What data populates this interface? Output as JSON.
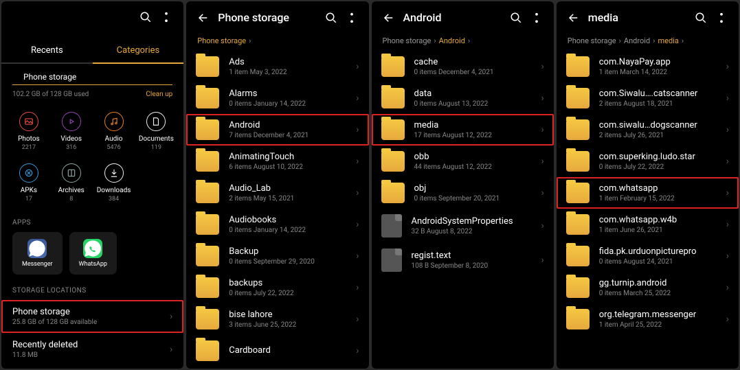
{
  "panel1": {
    "tabs": {
      "recents": "Recents",
      "categories": "Categories"
    },
    "storage_label": "Phone storage",
    "usage": "102.2 GB of 128 GB used",
    "cleanup": "Clean up",
    "cats": [
      {
        "name": "Photos",
        "count": "2217",
        "color": "#e84c3d"
      },
      {
        "name": "Videos",
        "count": "316",
        "color": "#8e44ad"
      },
      {
        "name": "Audio",
        "count": "5476",
        "color": "#e67e22"
      },
      {
        "name": "Documents",
        "count": "119",
        "color": "#ecf0f1"
      },
      {
        "name": "APKs",
        "count": "17",
        "color": "#3498db"
      },
      {
        "name": "Archives",
        "count": "8",
        "color": "#95a5a6"
      },
      {
        "name": "Downloads",
        "count": "384",
        "color": "#ecf0f1"
      }
    ],
    "apps_label": "APPS",
    "apps": [
      {
        "name": "Messenger"
      },
      {
        "name": "WhatsApp"
      }
    ],
    "loc_label": "STORAGE LOCATIONS",
    "locs": [
      {
        "name": "Phone storage",
        "meta": "25.8 GB of 128 GB available",
        "hl": true
      },
      {
        "name": "Recently deleted",
        "meta": "11.8 MB",
        "hl": false
      }
    ]
  },
  "panel2": {
    "title": "Phone storage",
    "crumbs": [
      "Phone storage"
    ],
    "items": [
      {
        "name": "Ads",
        "meta": "1 item    May 3, 2022",
        "type": "folder"
      },
      {
        "name": "Alarms",
        "meta": "0 items    January 14, 2022",
        "type": "folder"
      },
      {
        "name": "Android",
        "meta": "7 items    December 4, 2021",
        "type": "folder",
        "hl": true
      },
      {
        "name": "AnimatingTouch",
        "meta": "6 items    August 10, 2022",
        "type": "folder"
      },
      {
        "name": "Audio_Lab",
        "meta": "2 items    May 15, 2021",
        "type": "folder"
      },
      {
        "name": "Audiobooks",
        "meta": "0 items    January 14, 2022",
        "type": "folder"
      },
      {
        "name": "Backup",
        "meta": "0 items    September 29, 2020",
        "type": "folder"
      },
      {
        "name": "backups",
        "meta": "0 items    July 22, 2022",
        "type": "folder"
      },
      {
        "name": "bise lahore",
        "meta": "3 items    June 25, 2022",
        "type": "folder"
      },
      {
        "name": "Cardboard",
        "meta": "",
        "type": "folder"
      }
    ]
  },
  "panel3": {
    "title": "Android",
    "crumbs": [
      "Phone storage",
      "Android"
    ],
    "items": [
      {
        "name": "cache",
        "meta": "0 items    December 4, 2021",
        "type": "folder"
      },
      {
        "name": "data",
        "meta": "0 items    August 13, 2022",
        "type": "folder"
      },
      {
        "name": "media",
        "meta": "17 items    August 12, 2022",
        "type": "folder",
        "hl": true
      },
      {
        "name": "obb",
        "meta": "44 items    August 12, 2022",
        "type": "folder"
      },
      {
        "name": "obj",
        "meta": "0 items    September 20, 2021",
        "type": "folder"
      },
      {
        "name": "AndroidSystemProperties",
        "meta": "32 B    August 8, 2022",
        "type": "file"
      },
      {
        "name": "regist.text",
        "meta": "108 B    September 8, 2020",
        "type": "file"
      }
    ]
  },
  "panel4": {
    "title": "media",
    "crumbs": [
      "Phone storage",
      "Android",
      "media"
    ],
    "items": [
      {
        "name": "com.NayaPay.app",
        "meta": "1 item    March 14, 2022",
        "type": "folder"
      },
      {
        "name": "com.Siwalu….catscanner",
        "meta": "2 items    August 18, 2021",
        "type": "folder"
      },
      {
        "name": "com.siwalu…dogscanner",
        "meta": "2 items    July 26, 2021",
        "type": "folder"
      },
      {
        "name": "com.superking.ludo.star",
        "meta": "0 items    July 22, 2022",
        "type": "folder"
      },
      {
        "name": "com.whatsapp",
        "meta": "1 item    February 15, 2022",
        "type": "folder",
        "hl": true
      },
      {
        "name": "com.whatsapp.w4b",
        "meta": "1 item    June 26, 2021",
        "type": "folder"
      },
      {
        "name": "fida.pk.urduonpicturepro",
        "meta": "0 items    August 24, 2021",
        "type": "folder"
      },
      {
        "name": "gg.turnip.android",
        "meta": "0 items    March 25, 2022",
        "type": "folder"
      },
      {
        "name": "org.telegram.messenger",
        "meta": "1 item    April 25, 2022",
        "type": "folder"
      }
    ]
  }
}
